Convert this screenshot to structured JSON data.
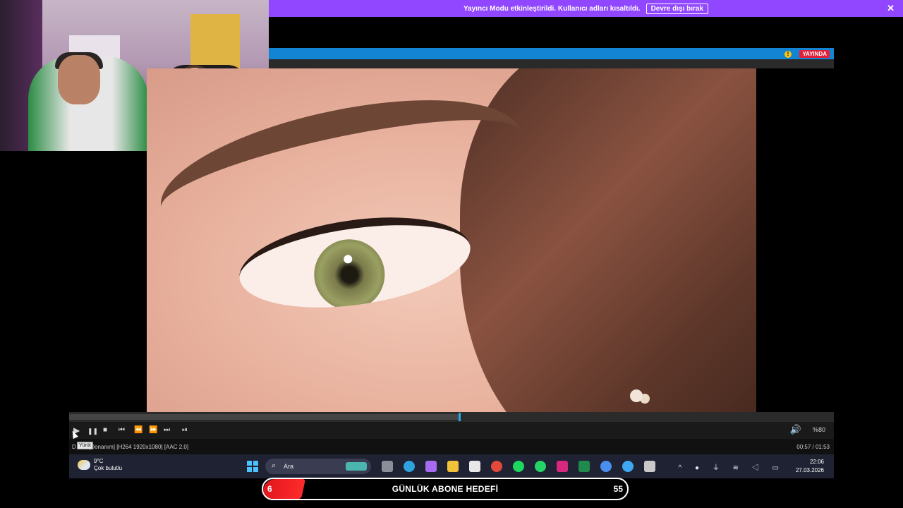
{
  "banner": {
    "message": "Yayıncı Modu etkinleştirildi. Kullanıcı adları kısaltıldı.",
    "disable_label": "Devre dışı bırak",
    "close_glyph": "✕"
  },
  "stream_header": {
    "live_badge": "YAYINDA",
    "warn_glyph": "!"
  },
  "player": {
    "progress": 0.51,
    "volume_label": "%80",
    "tooltip": "Yürüt",
    "status_left": "D   ıldı [Donanım]   [H264 1920x1080]   [AAC 2.0]",
    "time": "00:57 / 01:53",
    "buttons": {
      "play": "▶",
      "pause": "❚❚",
      "stop": "■",
      "prev": "⏮",
      "rewind": "⏪",
      "forward": "⏩",
      "next": "⏭",
      "frame": "⏯",
      "volume": "🔊"
    }
  },
  "taskbar": {
    "weather_temp": "9°C",
    "weather_desc": "Çok bulutlu",
    "search_label": "Ara",
    "search_glyph": "⌕",
    "clock_time": "22:06",
    "clock_date": "27.03.2026",
    "tray_glyphs": "^ ● ⏚ ≋ ◁ ▭",
    "apps": [
      {
        "name": "task-view-icon",
        "color": "#8a8e99"
      },
      {
        "name": "edge-icon",
        "color": "#2fa3e0"
      },
      {
        "name": "copilot-icon",
        "color": "#a66bf0"
      },
      {
        "name": "file-explorer-icon",
        "color": "#f2c13a"
      },
      {
        "name": "store-icon",
        "color": "#e8e8e8"
      },
      {
        "name": "chrome-icon",
        "color": "#e2493b"
      },
      {
        "name": "spotify-icon",
        "color": "#1ed760"
      },
      {
        "name": "whatsapp-icon",
        "color": "#25d366"
      },
      {
        "name": "instagram-icon",
        "color": "#d6287c"
      },
      {
        "name": "excel-icon",
        "color": "#1f8a4c"
      },
      {
        "name": "chrome-profile-icon",
        "color": "#4a8ff0"
      },
      {
        "name": "cloud-app-icon",
        "color": "#3fa8f4"
      },
      {
        "name": "obs-icon",
        "color": "#c9c9c9"
      }
    ]
  },
  "goal": {
    "current": "6",
    "title": "GÜNLÜK ABONE HEDEFİ",
    "target": "55",
    "progress": 0.11
  }
}
